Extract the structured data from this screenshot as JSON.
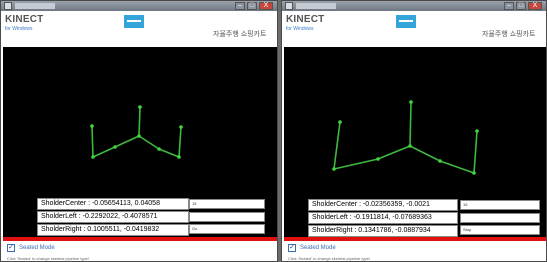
{
  "colors": {
    "skeleton": "#3fb83f",
    "joint": "#3fd63f",
    "accent_bar": "#e01010",
    "kinect_blue": "#35a4d9"
  },
  "left": {
    "header": {
      "brand": "KINECT",
      "sub": "for Windows",
      "app_title": "자율주행 쇼핑카트"
    },
    "titlebar": {
      "minimize": "–",
      "maximize": "□",
      "close": "X"
    },
    "readouts": {
      "center": "SholderCenter : -0.05654113, 0.04058",
      "left": "SholderLeft : -0.2292022, -0.4078571",
      "right": "SholderRight : 0.1005511, -0.0419832"
    },
    "side_boxes": [
      "15",
      "",
      "Go"
    ],
    "seated_label": "Seated Mode",
    "hint": "Click 'Seated' to change skeletal pipeline type!"
  },
  "right": {
    "header": {
      "brand": "KINECT",
      "sub": "for Windows",
      "app_title": "자율주행 쇼핑카트"
    },
    "titlebar": {
      "minimize": "–",
      "maximize": "□",
      "close": "X"
    },
    "readouts": {
      "center": "SholderCenter : -0.02356359, -0.0021",
      "left": "SholderLeft : -0.1911814, -0.07689363",
      "right": "SholderRight : 0.1341786, -0.0887934"
    },
    "side_boxes": [
      "15",
      "",
      "Stop"
    ],
    "seated_label": "Seated Mode",
    "hint": "Click 'Seated' to change skeletal pipeline type!"
  }
}
